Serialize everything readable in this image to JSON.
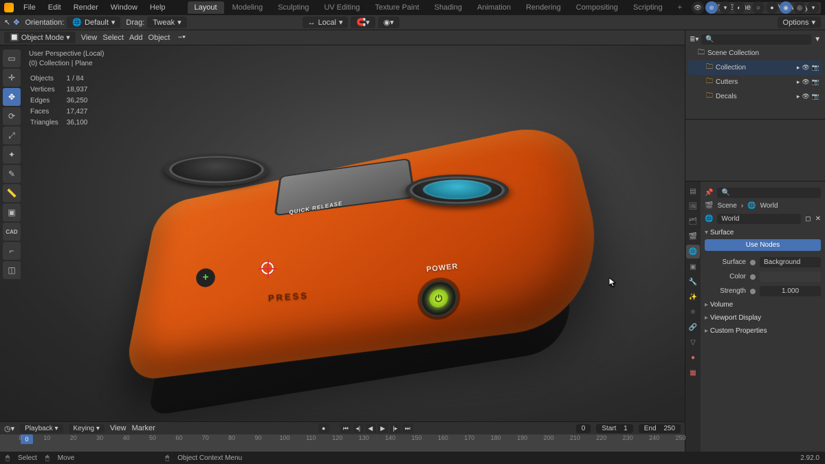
{
  "menus": {
    "file": "File",
    "edit": "Edit",
    "render": "Render",
    "window": "Window",
    "help": "Help"
  },
  "workspaces": {
    "layout": "Layout",
    "modeling": "Modeling",
    "sculpting": "Sculpting",
    "uv": "UV Editing",
    "texpaint": "Texture Paint",
    "shading": "Shading",
    "anim": "Animation",
    "render": "Rendering",
    "comp": "Compositing",
    "script": "Scripting",
    "add": "+"
  },
  "top_right": {
    "scene": "Scene",
    "viewlayer": "View Layer"
  },
  "toolbar2": {
    "orientation": "Orientation:",
    "orient_val": "Default",
    "drag": "Drag:",
    "drag_val": "Tweak",
    "local": "Local",
    "options": "Options"
  },
  "header3": {
    "mode": "Object Mode",
    "view": "View",
    "select": "Select",
    "add": "Add",
    "object": "Object"
  },
  "overlay": {
    "persp": "User Perspective (Local)",
    "coll": "(0) Collection | Plane",
    "stats": {
      "objects_l": "Objects",
      "objects_v": "1 / 84",
      "verts_l": "Vertices",
      "verts_v": "18,937",
      "edges_l": "Edges",
      "edges_v": "36,250",
      "faces_l": "Faces",
      "faces_v": "17,427",
      "tris_l": "Triangles",
      "tris_v": "36,100"
    }
  },
  "model_text": {
    "power": "POWER",
    "press": "PRESS",
    "quick": "QUICK RELEASE"
  },
  "timeline": {
    "playback": "Playback",
    "keying": "Keying",
    "view": "View",
    "marker": "Marker",
    "cur": "0",
    "cur_frame": "0",
    "start_l": "Start",
    "start_v": "1",
    "end_l": "End",
    "end_v": "250",
    "ticks": [
      "0",
      "10",
      "20",
      "30",
      "40",
      "50",
      "60",
      "70",
      "80",
      "90",
      "100",
      "110",
      "120",
      "130",
      "140",
      "150",
      "160",
      "170",
      "180",
      "190",
      "200",
      "210",
      "220",
      "230",
      "240",
      "250"
    ]
  },
  "status": {
    "select": "Select",
    "move": "Move",
    "ctx": "Object Context Menu",
    "version": "2.92.0"
  },
  "outliner": {
    "search_ph": "",
    "root": "Scene Collection",
    "items": [
      {
        "name": "Collection"
      },
      {
        "name": "Cutters"
      },
      {
        "name": "Decals"
      }
    ]
  },
  "properties": {
    "breadcrumb_scene": "Scene",
    "breadcrumb_world": "World",
    "world_dd": "World",
    "surface": "Surface",
    "use_nodes": "Use Nodes",
    "surface_l": "Surface",
    "surface_v": "Background",
    "color_l": "Color",
    "strength_l": "Strength",
    "strength_v": "1.000",
    "volume": "Volume",
    "vpdisplay": "Viewport Display",
    "custom": "Custom Properties"
  }
}
